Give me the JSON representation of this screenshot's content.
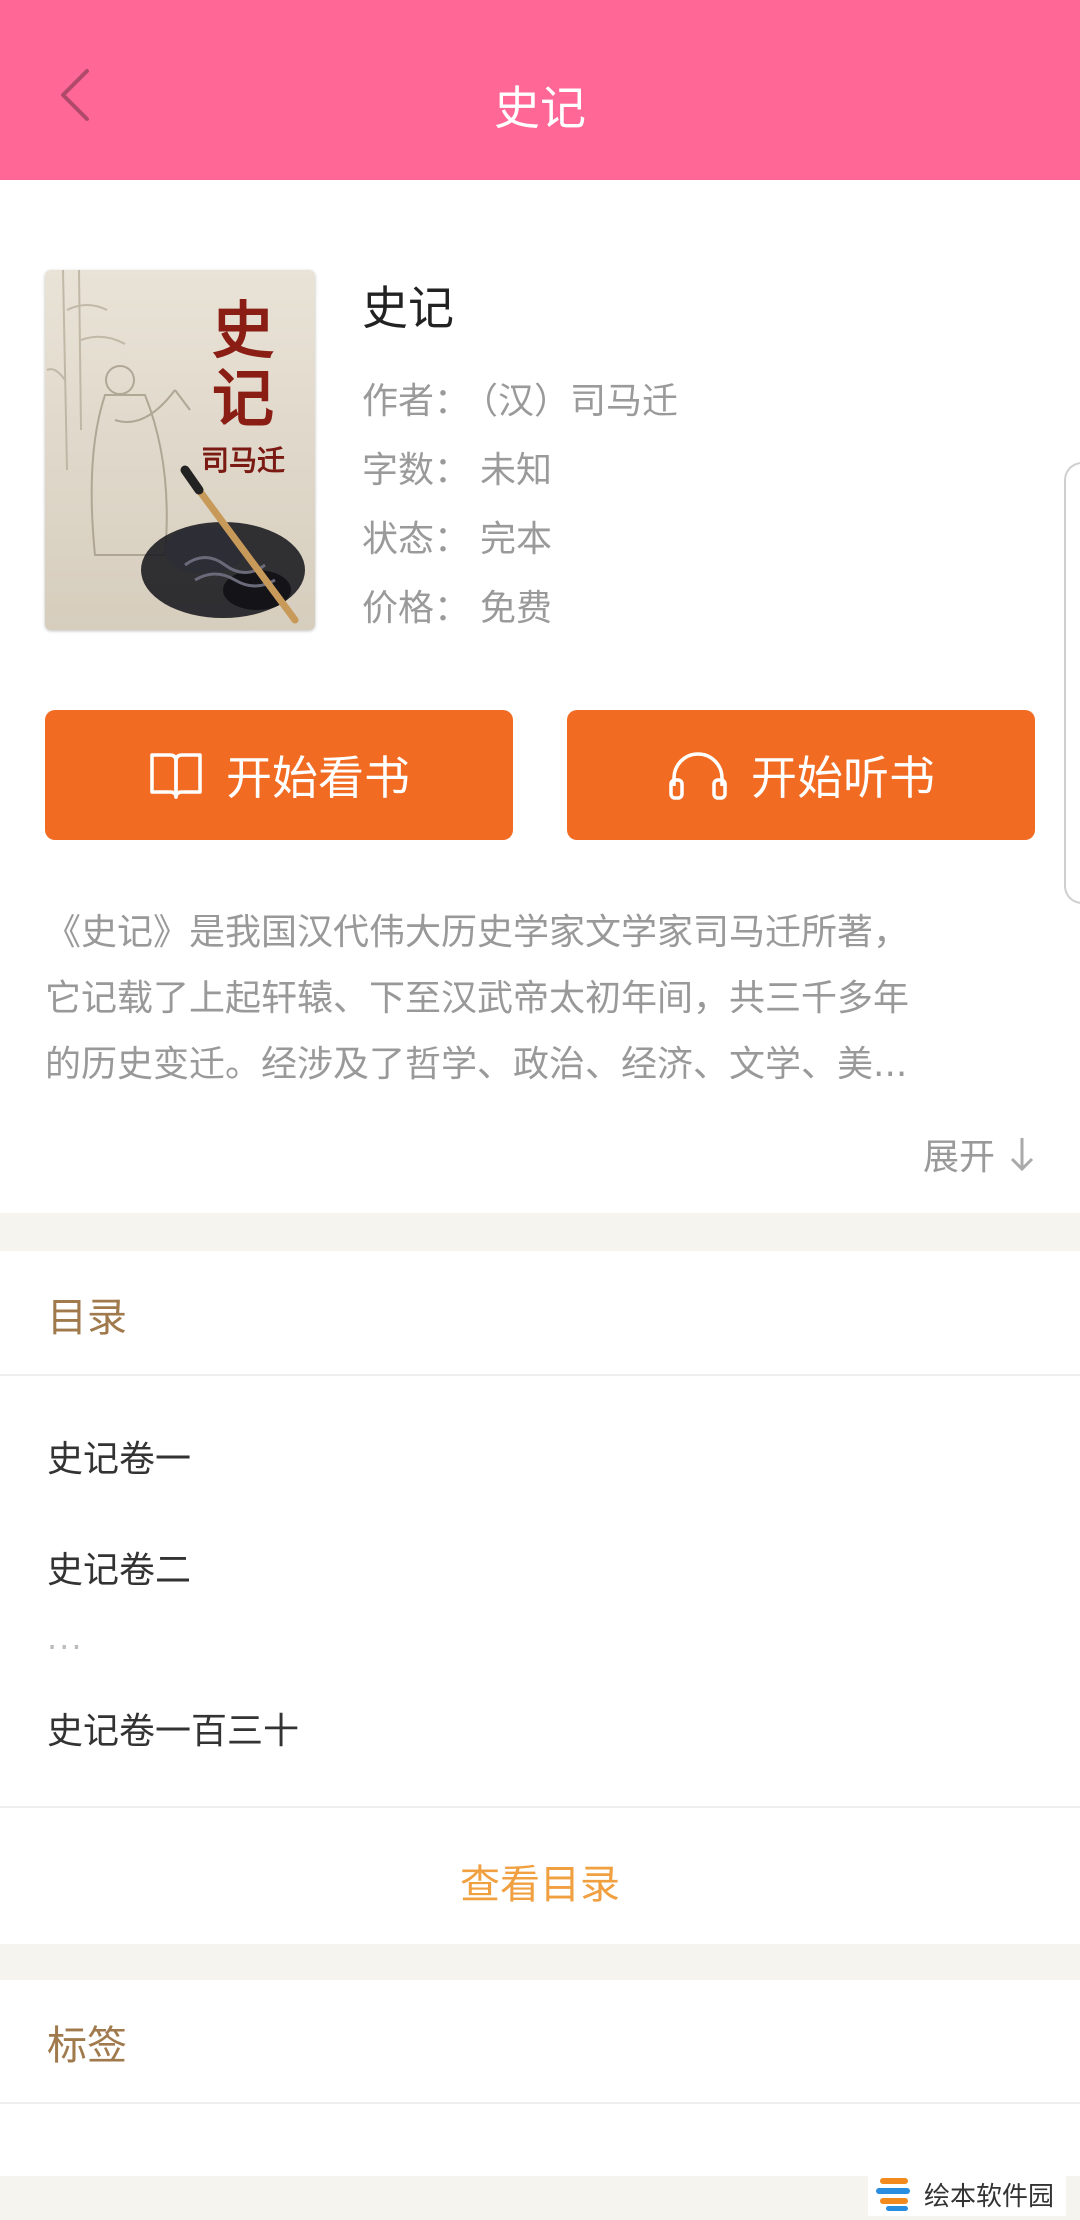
{
  "header": {
    "title": "史记",
    "back_icon": "chevron-left-icon"
  },
  "book": {
    "title": "史记",
    "cover_text": {
      "main": "史记",
      "sub": "司马迁"
    },
    "meta": [
      {
        "label": "作者：",
        "value": "（汉）司马迁"
      },
      {
        "label": "字数：",
        "value": "未知"
      },
      {
        "label": "状态：",
        "value": "完本"
      },
      {
        "label": "价格：",
        "value": "免费"
      }
    ]
  },
  "actions": {
    "read_label": "开始看书",
    "read_icon": "book-open-icon",
    "listen_label": "开始听书",
    "listen_icon": "headphones-icon",
    "button_color": "#f26b22"
  },
  "description": {
    "lines": [
      "《史记》是我国汉代伟大历史学家文学家司马迁所著，",
      "它记载了上起轩辕、下至汉武帝太初年间，共三千多年",
      "的历史变迁。经涉及了哲学、政治、经济、文学、美..."
    ],
    "expand_label": "展开",
    "expand_icon": "arrow-down-icon"
  },
  "toc": {
    "title": "目录",
    "chapters": [
      "史记卷一",
      "史记卷二",
      "史记卷一百三十"
    ],
    "ellipsis": "···",
    "view_label": "查看目录"
  },
  "tags": {
    "title": "标签"
  },
  "watermark": {
    "text": "绘本软件园"
  },
  "colors": {
    "header": "#ff6796",
    "accent": "#f26b22",
    "section_title": "#a07a4c",
    "link": "#f0a040"
  }
}
